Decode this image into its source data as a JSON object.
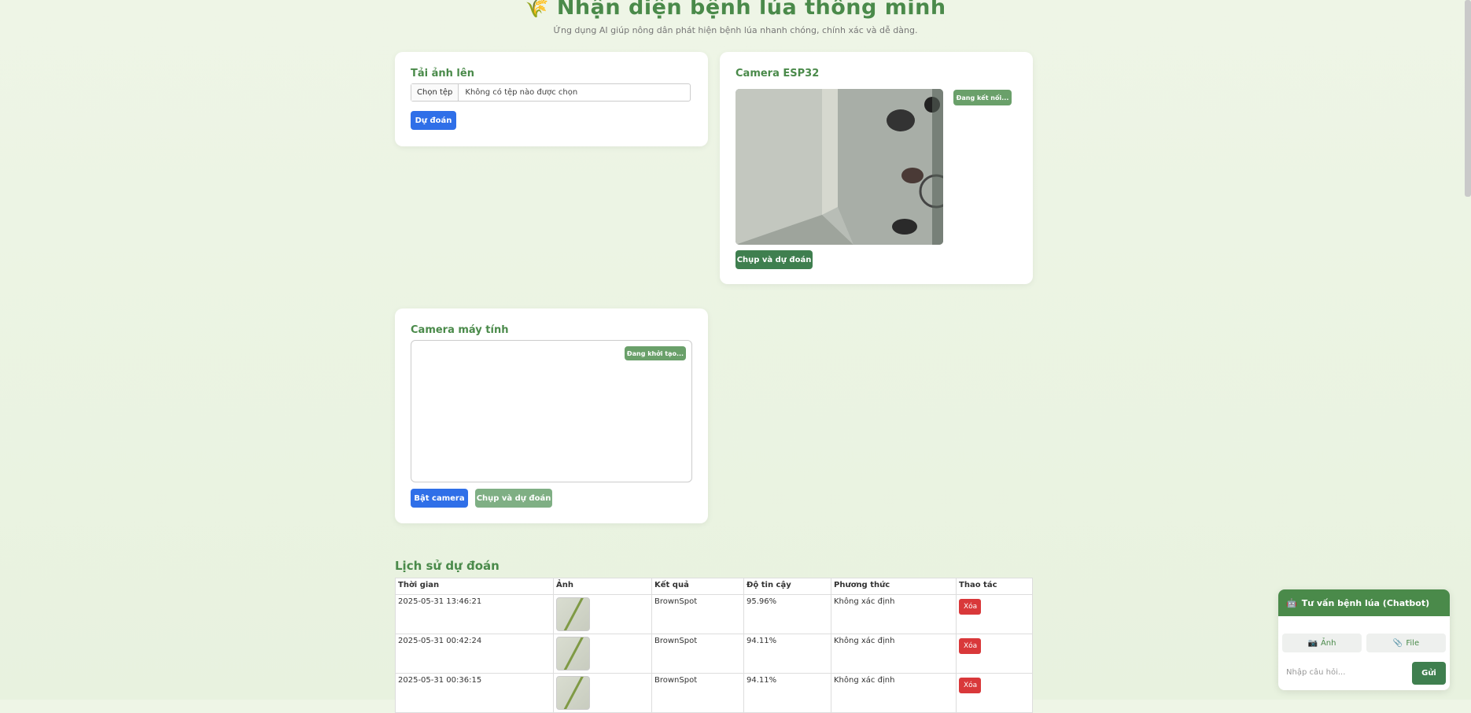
{
  "header": {
    "title": "Nhận diện bệnh lúa thông minh",
    "title_icon": "rice-plant-icon",
    "subtitle": "Ứng dụng AI giúp nông dân phát hiện bệnh lúa nhanh chóng, chính xác và dễ dàng."
  },
  "upload": {
    "title": "Tải ảnh lên",
    "choose_label": "Chọn tệp",
    "no_file_label": "Không có tệp nào được chọn",
    "predict_button": "Dự đoán"
  },
  "esp32": {
    "title": "Camera ESP32",
    "status_badge": "Đang kết nối...",
    "capture_button": "Chụp và dự đoán"
  },
  "pc_camera": {
    "title": "Camera máy tính",
    "status_badge": "Đang khởi tạo...",
    "enable_button": "Bật camera",
    "capture_button": "Chụp và dự đoán"
  },
  "history": {
    "title": "Lịch sử dự đoán",
    "columns": [
      "Thời gian",
      "Ảnh",
      "Kết quả",
      "Độ tin cậy",
      "Phương thức",
      "Thao tác"
    ],
    "rows": [
      {
        "time": "2025-05-31 13:46:21",
        "result": "BrownSpot",
        "confidence": "95.96%",
        "method": "Không xác định",
        "action": "Xóa"
      },
      {
        "time": "2025-05-31 00:42:24",
        "result": "BrownSpot",
        "confidence": "94.11%",
        "method": "Không xác định",
        "action": "Xóa"
      },
      {
        "time": "2025-05-31 00:36:15",
        "result": "BrownSpot",
        "confidence": "94.11%",
        "method": "Không xác định",
        "action": "Xóa"
      }
    ]
  },
  "chatbot": {
    "title": "Tư vấn bệnh lúa (Chatbot)",
    "image_button": "Ảnh",
    "file_button": "File",
    "input_placeholder": "Nhập câu hỏi...",
    "send_button": "Gửi"
  },
  "colors": {
    "accent_green": "#4a8a4a",
    "button_blue": "#2f6fe8",
    "delete_red": "#d9383a"
  }
}
